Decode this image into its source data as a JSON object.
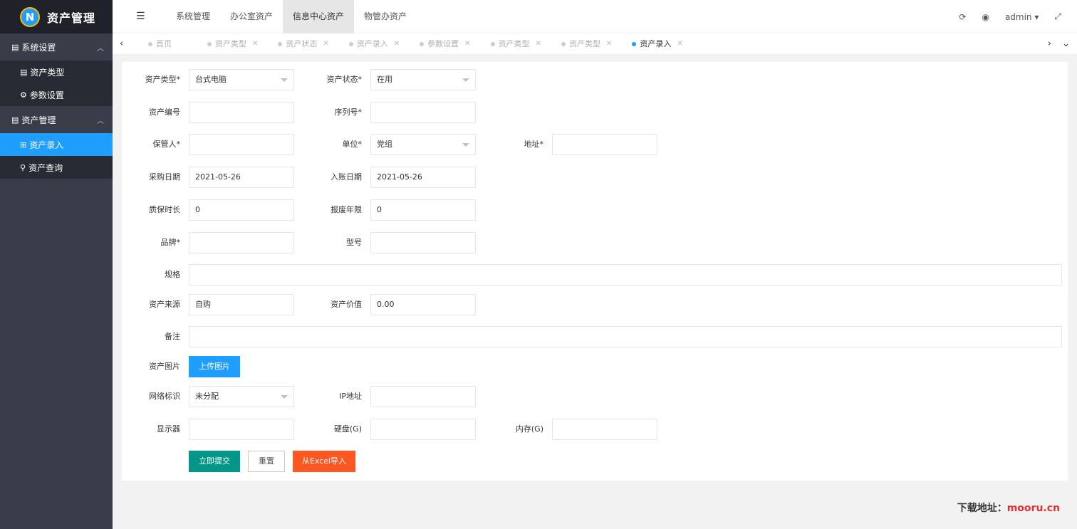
{
  "app": {
    "title": "资产管理",
    "logo_letter": "N"
  },
  "sidebar": {
    "groups": [
      {
        "label": "系统设置",
        "items": [
          "资产类型",
          "参数设置"
        ]
      },
      {
        "label": "资产管理",
        "items": [
          "资产录入",
          "资产查询"
        ]
      }
    ]
  },
  "header": {
    "menu": [
      "系统管理",
      "办公室资产",
      "信息中心资产",
      "物管办资产"
    ],
    "user": "admin"
  },
  "tabs": [
    "首页",
    "资产类型",
    "资产状态",
    "资产录入",
    "参数设置",
    "资产类型",
    "资产类型",
    "资产录入"
  ],
  "form": {
    "asset_type": {
      "label": "资产类型*",
      "value": "台式电脑"
    },
    "asset_status": {
      "label": "资产状态*",
      "value": "在用"
    },
    "asset_no": {
      "label": "资产编号",
      "value": ""
    },
    "serial_no": {
      "label": "序列号*",
      "value": ""
    },
    "custodian": {
      "label": "保管人*",
      "value": ""
    },
    "unit": {
      "label": "单位*",
      "value": "党组"
    },
    "address": {
      "label": "地址*",
      "value": ""
    },
    "purchase_date": {
      "label": "采购日期",
      "value": "2021-05-26"
    },
    "entry_date": {
      "label": "入账日期",
      "value": "2021-05-26"
    },
    "warranty": {
      "label": "质保时长",
      "value": "0"
    },
    "scrap_years": {
      "label": "报废年限",
      "value": "0"
    },
    "brand": {
      "label": "品牌*",
      "value": ""
    },
    "model": {
      "label": "型号",
      "value": ""
    },
    "spec": {
      "label": "规格",
      "value": ""
    },
    "source": {
      "label": "资产来源",
      "value": "自购"
    },
    "price": {
      "label": "资产价值",
      "value": "0.00"
    },
    "remark": {
      "label": "备注",
      "value": ""
    },
    "image": {
      "label": "资产图片",
      "button": "上传图片"
    },
    "network": {
      "label": "网络标识",
      "value": "未分配"
    },
    "ip": {
      "label": "IP地址",
      "value": ""
    },
    "monitor": {
      "label": "显示器",
      "value": ""
    },
    "disk": {
      "label": "硬盘(G)",
      "value": ""
    },
    "memory": {
      "label": "内存(G)",
      "value": ""
    }
  },
  "actions": {
    "submit": "立即提交",
    "reset": "重置",
    "import": "从Excel导入"
  },
  "watermark": {
    "prefix": "下载地址：",
    "site": "mooru.cn"
  }
}
